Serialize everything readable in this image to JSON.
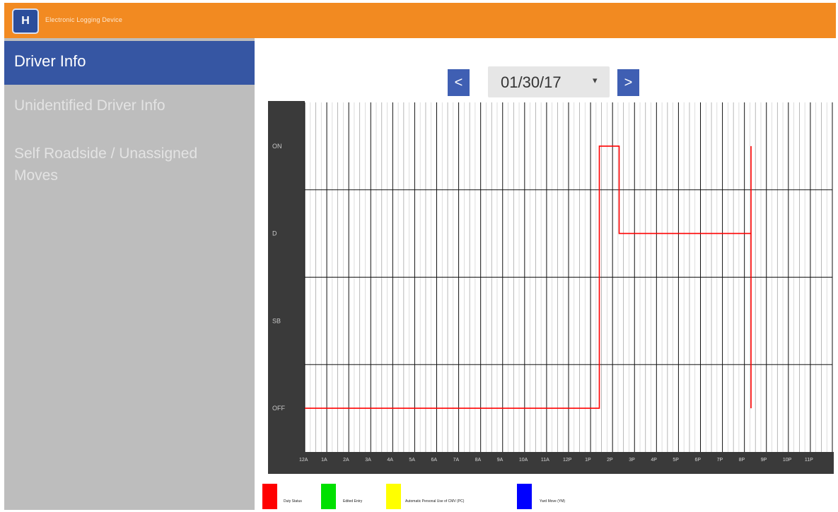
{
  "header": {
    "app_title": "Electronic Logging Device",
    "logo_glyph": "H",
    "colors": {
      "bar": "#f28a21",
      "accent": "#3656a3"
    }
  },
  "sidebar": {
    "items": [
      {
        "label": "Driver Info",
        "active": true
      },
      {
        "label": "Unidentified Driver Info",
        "active": false
      },
      {
        "label": "Self Roadside / Unassigned Moves",
        "active": false
      }
    ]
  },
  "date_nav": {
    "prev_label": "<",
    "next_label": ">",
    "date": "01/30/17",
    "caret": "▾"
  },
  "chart_data": {
    "type": "line",
    "y_labels": [
      "OFF",
      "SB",
      "D",
      "ON"
    ],
    "x_ticks": [
      "12A",
      "1A",
      "2A",
      "3A",
      "4A",
      "5A",
      "6A",
      "7A",
      "8A",
      "9A",
      "10A",
      "11A",
      "12P",
      "1P",
      "2P",
      "3P",
      "4P",
      "5P",
      "6P",
      "7P",
      "8P",
      "9P",
      "10P",
      "11P"
    ],
    "series": [
      {
        "name": "Duty Status",
        "color": "#ff0000",
        "points": [
          [
            0,
            "OFF"
          ],
          [
            13.4,
            "OFF"
          ],
          [
            13.4,
            "ON"
          ],
          [
            14.3,
            "ON"
          ],
          [
            14.3,
            "D"
          ],
          [
            20.3,
            "D"
          ],
          [
            20.3,
            "ON"
          ],
          [
            20.3,
            "OFF"
          ]
        ]
      }
    ],
    "legend": [
      {
        "label": "Duty Status",
        "color": "#ff0000"
      },
      {
        "label": "Edited Entry",
        "color": "#00e000"
      },
      {
        "label": "Automatic Personal Use of CMV (PC)",
        "color": "#ffff00"
      },
      {
        "label": "Yard Move (YM)",
        "color": "#0000ff"
      }
    ]
  }
}
